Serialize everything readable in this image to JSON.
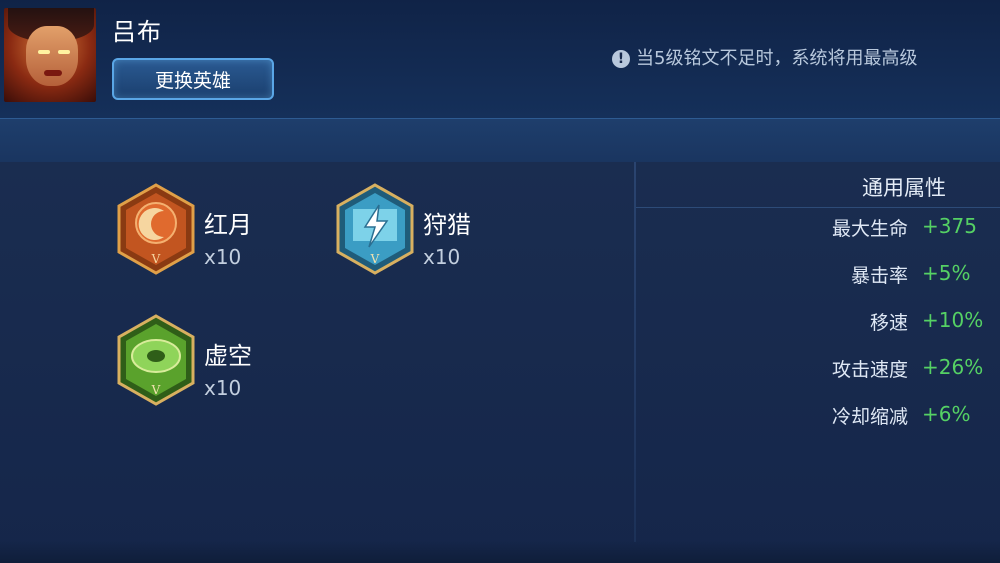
{
  "hero": {
    "name": "吕布",
    "change_label": "更换英雄"
  },
  "notice": {
    "icon": "info-icon",
    "text": "当5级铭文不足时，系统将用最高级"
  },
  "runes": [
    {
      "name": "红月",
      "count": "x10",
      "icon": "red-moon-rune-icon",
      "color": "#d9652a"
    },
    {
      "name": "狩猎",
      "count": "x10",
      "icon": "hunt-rune-icon",
      "color": "#4fb6d8"
    },
    {
      "name": "虚空",
      "count": "x10",
      "icon": "void-rune-icon",
      "color": "#6cbd3a"
    }
  ],
  "attributes": {
    "title": "通用属性",
    "items": [
      {
        "label": "最大生命",
        "value": "+375"
      },
      {
        "label": "暴击率",
        "value": "+5%"
      },
      {
        "label": "移速",
        "value": "+10%"
      },
      {
        "label": "攻击速度",
        "value": "+26%"
      },
      {
        "label": "冷却缩减",
        "value": "+6%"
      }
    ]
  },
  "colors": {
    "background": "#16284a",
    "positive_value": "#55d164",
    "button_border": "#5aa6e6"
  }
}
